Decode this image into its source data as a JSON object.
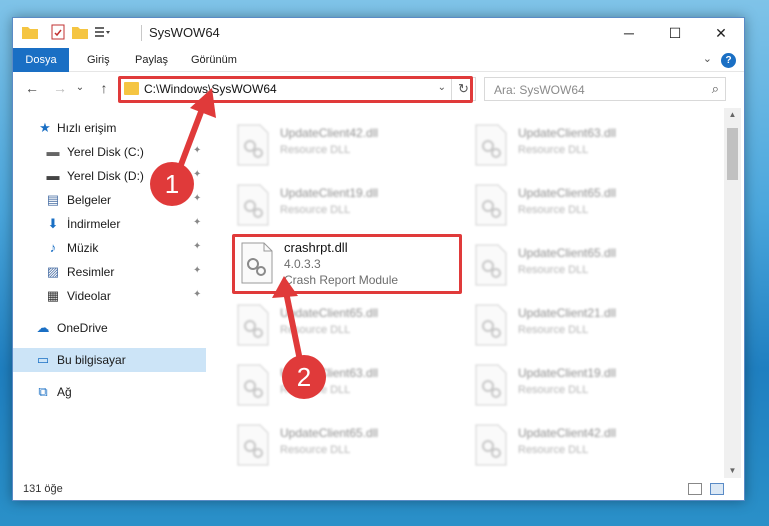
{
  "window": {
    "title": "SysWOW64",
    "controls": {
      "minimize": "─",
      "maximize": "☐",
      "close": "✕"
    }
  },
  "ribbon": {
    "tabs": [
      "Dosya",
      "Giriş",
      "Paylaş",
      "Görünüm"
    ],
    "expand_icon": "⌄",
    "help": "?"
  },
  "nav": {
    "back": "←",
    "forward": "→",
    "recent": "⌄",
    "up": "↑",
    "address": "C:\\Windows\\SysWOW64",
    "address_dropdown": "⌄",
    "refresh": "↻",
    "search_placeholder": "Ara: SysWOW64",
    "search_icon": "⌕"
  },
  "sidebar": {
    "items": [
      {
        "label": "Hızlı erişim",
        "icon": "★",
        "pinned": false
      },
      {
        "label": "Yerel Disk (C:)",
        "icon": "▬",
        "pinned": true
      },
      {
        "label": "Yerel Disk (D:)",
        "icon": "▬",
        "pinned": true
      },
      {
        "label": "Belgeler",
        "icon": "▤",
        "pinned": true
      },
      {
        "label": "İndirmeler",
        "icon": "⬇",
        "pinned": true
      },
      {
        "label": "Müzik",
        "icon": "♪",
        "pinned": true
      },
      {
        "label": "Resimler",
        "icon": "▨",
        "pinned": true
      },
      {
        "label": "Videolar",
        "icon": "▦",
        "pinned": true
      },
      {
        "label": "OneDrive",
        "icon": "☁",
        "pinned": false
      },
      {
        "label": "Bu bilgisayar",
        "icon": "▭",
        "pinned": false,
        "selected": true
      },
      {
        "label": "Ağ",
        "icon": "⧉",
        "pinned": false
      }
    ],
    "pin_glyph": "✦"
  },
  "files": {
    "left": [
      {
        "name": "UpdateClient42.dll",
        "desc": "Resource DLL"
      },
      {
        "name": "UpdateClient19.dll",
        "desc": "Resource DLL"
      },
      {
        "name": "UpdateClient65.dll",
        "desc": "Resource DLL"
      },
      {
        "name": "UpdateClient63.dll",
        "desc": "Resource DLL"
      },
      {
        "name": "UpdateClient65.dll",
        "desc": "Resource DLL"
      }
    ],
    "right": [
      {
        "name": "UpdateClient63.dll",
        "desc": "Resource DLL"
      },
      {
        "name": "UpdateClient65.dll",
        "desc": "Resource DLL"
      },
      {
        "name": "UpdateClient65.dll",
        "desc": "Resource DLL"
      },
      {
        "name": "UpdateClient21.dll",
        "desc": "Resource DLL"
      },
      {
        "name": "UpdateClient19.dll",
        "desc": "Resource DLL"
      },
      {
        "name": "UpdateClient42.dll",
        "desc": "Resource DLL"
      },
      {
        "name": "UpdateClient19.dll",
        "desc": "Resource DLL"
      }
    ],
    "featured": {
      "name": "crashrpt.dll",
      "version": "4.0.3.3",
      "desc": "Crash Report Module"
    }
  },
  "status": {
    "count": "131 öğe"
  },
  "annotations": {
    "step1": "1",
    "step2": "2",
    "color": "#e03a3a"
  }
}
